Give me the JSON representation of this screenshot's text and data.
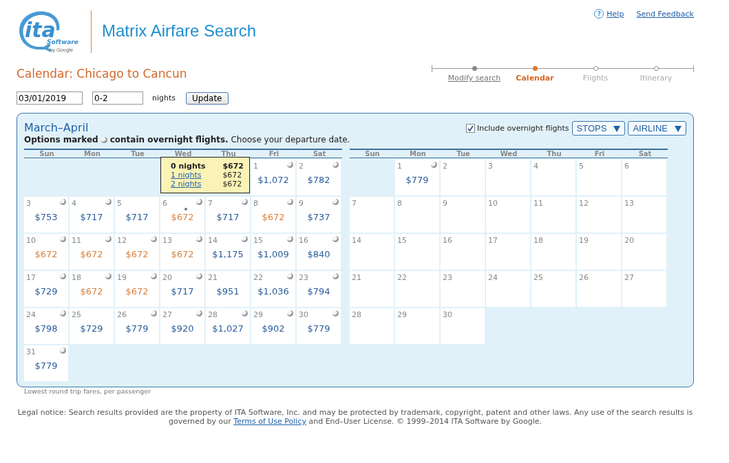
{
  "logo": {
    "main": "ita",
    "sub": "Software",
    "by": "by Google"
  },
  "app_title": "Matrix Airfare Search",
  "top_links": [
    {
      "label": "Help",
      "icon": "?"
    },
    {
      "label": "Send Feedback"
    }
  ],
  "page_title": "Calendar: Chicago to Cancun",
  "steps": [
    {
      "label": "Modify search",
      "visited": true,
      "selected": false
    },
    {
      "label": "Calendar",
      "visited": true,
      "selected": true
    },
    {
      "label": "Flights",
      "visited": false,
      "selected": false
    },
    {
      "label": "Itinerary",
      "visited": false,
      "selected": false
    }
  ],
  "form": {
    "date": "03/01/2019",
    "nights": "0-2",
    "nights_label": "nights",
    "button": "Update"
  },
  "calendar": {
    "title": "March–April",
    "legend": {
      "before": "Options marked",
      "after": "**contain overnight flights.** Choose your departure date."
    },
    "overnight_option": {
      "label": "Include overnight flights",
      "checked": true
    },
    "filters": [
      "STOPS",
      "AIRLINE"
    ],
    "months": [
      {
        "weekdays": [
          "Sun",
          "Mon",
          "Tue",
          "Wed",
          "Thu",
          "Fri",
          "Sat"
        ],
        "weeks": [
          [
            {
              "kind": "blank"
            },
            {
              "kind": "blank"
            },
            {
              "kind": "blank"
            },
            {
              "kind": "blank"
            },
            {
              "kind": "blank"
            },
            {
              "day": "1",
              "price": "$1,072",
              "overnight": true,
              "cheapest": false,
              "hovered": false
            },
            {
              "day": "2",
              "price": "$782",
              "overnight": true,
              "cheapest": false,
              "hovered": false
            }
          ],
          [
            {
              "day": "3",
              "price": "$753",
              "overnight": true,
              "cheapest": false,
              "hovered": false
            },
            {
              "day": "4",
              "price": "$717",
              "overnight": true,
              "cheapest": false,
              "hovered": false
            },
            {
              "day": "5",
              "price": "$717",
              "overnight": false,
              "cheapest": false,
              "hovered": false
            },
            {
              "day": "6",
              "price": "$672",
              "overnight": true,
              "cheapest": true,
              "hovered": true
            },
            {
              "day": "7",
              "price": "$717",
              "overnight": true,
              "cheapest": false,
              "hovered": false
            },
            {
              "day": "8",
              "price": "$672",
              "overnight": true,
              "cheapest": true,
              "hovered": false
            },
            {
              "day": "9",
              "price": "$737",
              "overnight": true,
              "cheapest": false,
              "hovered": false
            }
          ],
          [
            {
              "day": "10",
              "price": "$672",
              "overnight": true,
              "cheapest": true,
              "hovered": false
            },
            {
              "day": "11",
              "price": "$672",
              "overnight": true,
              "cheapest": true,
              "hovered": false
            },
            {
              "day": "12",
              "price": "$672",
              "overnight": true,
              "cheapest": true,
              "hovered": false
            },
            {
              "day": "13",
              "price": "$672",
              "overnight": true,
              "cheapest": true,
              "hovered": false
            },
            {
              "day": "14",
              "price": "$1,175",
              "overnight": true,
              "cheapest": false,
              "hovered": false
            },
            {
              "day": "15",
              "price": "$1,009",
              "overnight": true,
              "cheapest": false,
              "hovered": false
            },
            {
              "day": "16",
              "price": "$840",
              "overnight": true,
              "cheapest": false,
              "hovered": false
            }
          ],
          [
            {
              "day": "17",
              "price": "$729",
              "overnight": true,
              "cheapest": false,
              "hovered": false
            },
            {
              "day": "18",
              "price": "$672",
              "overnight": true,
              "cheapest": true,
              "hovered": false
            },
            {
              "day": "19",
              "price": "$672",
              "overnight": true,
              "cheapest": true,
              "hovered": false
            },
            {
              "day": "20",
              "price": "$717",
              "overnight": true,
              "cheapest": false,
              "hovered": false
            },
            {
              "day": "21",
              "price": "$951",
              "overnight": false,
              "cheapest": false,
              "hovered": false
            },
            {
              "day": "22",
              "price": "$1,036",
              "overnight": true,
              "cheapest": false,
              "hovered": false
            },
            {
              "day": "23",
              "price": "$794",
              "overnight": true,
              "cheapest": false,
              "hovered": false
            }
          ],
          [
            {
              "day": "24",
              "price": "$798",
              "overnight": true,
              "cheapest": false,
              "hovered": false
            },
            {
              "day": "25",
              "price": "$729",
              "overnight": false,
              "cheapest": false,
              "hovered": false
            },
            {
              "day": "26",
              "price": "$779",
              "overnight": true,
              "cheapest": false,
              "hovered": false
            },
            {
              "day": "27",
              "price": "$920",
              "overnight": true,
              "cheapest": false,
              "hovered": false
            },
            {
              "day": "28",
              "price": "$1,027",
              "overnight": true,
              "cheapest": false,
              "hovered": false
            },
            {
              "day": "29",
              "price": "$902",
              "overnight": true,
              "cheapest": false,
              "hovered": false
            },
            {
              "day": "30",
              "price": "$779",
              "overnight": true,
              "cheapest": false,
              "hovered": false
            }
          ],
          [
            {
              "day": "31",
              "price": "$779",
              "overnight": true,
              "cheapest": false,
              "hovered": false
            },
            {
              "kind": "blank"
            },
            {
              "kind": "blank"
            },
            {
              "kind": "blank"
            },
            {
              "kind": "blank"
            },
            {
              "kind": "blank"
            },
            {
              "kind": "blank"
            }
          ]
        ]
      },
      {
        "weekdays": [
          "Sun",
          "Mon",
          "Tue",
          "Wed",
          "Thu",
          "Fri",
          "Sat"
        ],
        "weeks": [
          [
            {
              "kind": "blank"
            },
            {
              "day": "1",
              "price": "$779",
              "overnight": true,
              "cheapest": false,
              "hovered": false
            },
            {
              "day": "2",
              "overnight": false
            },
            {
              "day": "3",
              "overnight": false
            },
            {
              "day": "4",
              "overnight": false
            },
            {
              "day": "5",
              "overnight": false
            },
            {
              "day": "6",
              "overnight": false
            }
          ],
          [
            {
              "day": "7",
              "overnight": false
            },
            {
              "day": "8",
              "overnight": false
            },
            {
              "day": "9",
              "overnight": false
            },
            {
              "day": "10",
              "overnight": false
            },
            {
              "day": "11",
              "overnight": false
            },
            {
              "day": "12",
              "overnight": false
            },
            {
              "day": "13",
              "overnight": false
            }
          ],
          [
            {
              "day": "14",
              "overnight": false
            },
            {
              "day": "15",
              "overnight": false
            },
            {
              "day": "16",
              "overnight": false
            },
            {
              "day": "17",
              "overnight": false
            },
            {
              "day": "18",
              "overnight": false
            },
            {
              "day": "19",
              "overnight": false
            },
            {
              "day": "20",
              "overnight": false
            }
          ],
          [
            {
              "day": "21",
              "overnight": false
            },
            {
              "day": "22",
              "overnight": false
            },
            {
              "day": "23",
              "overnight": false
            },
            {
              "day": "24",
              "overnight": false
            },
            {
              "day": "25",
              "overnight": false
            },
            {
              "day": "26",
              "overnight": false
            },
            {
              "day": "27",
              "overnight": false
            }
          ],
          [
            {
              "day": "28",
              "overnight": false
            },
            {
              "day": "29",
              "overnight": false
            },
            {
              "day": "30",
              "overnight": false
            },
            {
              "kind": "blank"
            },
            {
              "kind": "blank"
            },
            {
              "kind": "blank"
            },
            {
              "kind": "blank"
            }
          ]
        ]
      }
    ],
    "tooltip": [
      {
        "nights": "0 nights",
        "price": "$672",
        "current": true
      },
      {
        "nights": "1 nights",
        "price": "$672",
        "current": false
      },
      {
        "nights": "2 nights",
        "price": "$672",
        "current": false
      }
    ],
    "footnote": "Lowest round trip fares, per passenger"
  },
  "legal": {
    "before": "Legal notice: Search results provided are the property of ITA Software, Inc. and may be protected by trademark, copyright, patent and other laws. Any use of the search results is governed by our",
    "link": "Terms of Use Policy",
    "after": "and End–User License. © 1999–2014 ITA Software by Google."
  }
}
